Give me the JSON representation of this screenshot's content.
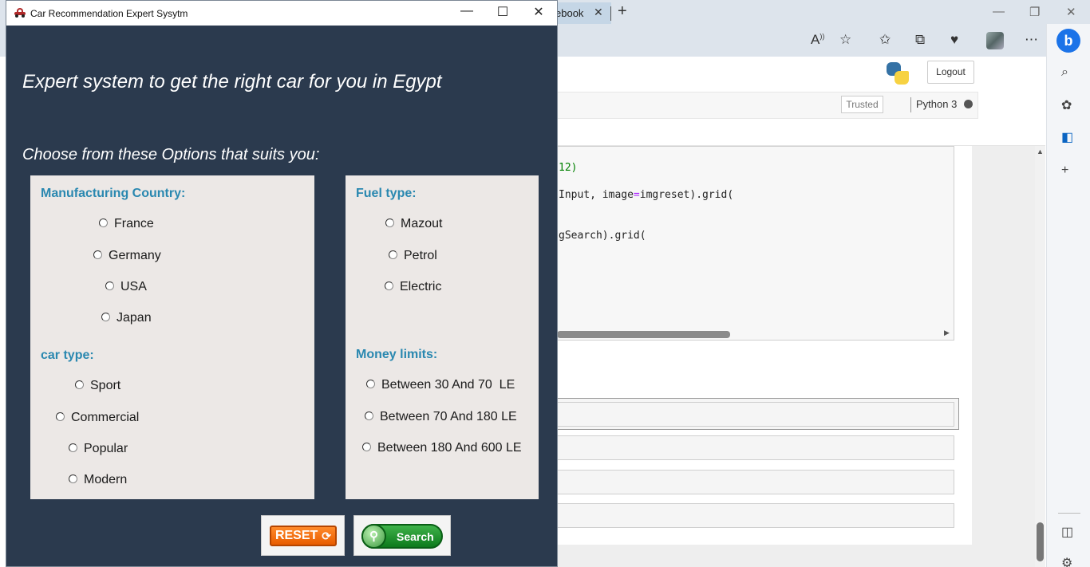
{
  "browser": {
    "tab_label": "ebook",
    "tab_close": "✕",
    "new_tab": "+",
    "win_minimize": "—",
    "win_restore": "❐",
    "win_close": "✕",
    "icons": [
      "read-aloud-icon",
      "add-favorite-icon",
      "favorites-icon",
      "collections-icon",
      "health-icon",
      "profile-icon",
      "more-icon"
    ],
    "sidebar_icons": [
      "bing-icon",
      "search-icon",
      "copilot-icon",
      "outlook-icon",
      "add-icon",
      "split-screen-icon",
      "settings-icon"
    ]
  },
  "jupyter": {
    "logout_label": "Logout",
    "trusted_label": "Trusted",
    "kernel_name": "Python 3",
    "code_lines": [
      {
        "pre": "12)",
        "num": ""
      },
      {
        "pre": "Input, image",
        "op": "=",
        "post": "imgreset).grid("
      },
      {
        "pre": "gSearch).grid(",
        "op": "",
        "post": ""
      }
    ]
  },
  "app": {
    "window_title": "Car Recommendation Expert Sysytm",
    "minimize": "—",
    "maximize": "☐",
    "close": "✕",
    "heading": "Expert system to get the right car for you in Egypt",
    "subheading": "Choose from these Options that suits you:",
    "groups": {
      "country": {
        "title": "Manufacturing Country:",
        "options": [
          "France",
          "Germany",
          "USA",
          "Japan"
        ]
      },
      "car_type": {
        "title": "car type:",
        "options": [
          "Sport",
          "Commercial",
          "Popular",
          "Modern"
        ]
      },
      "fuel": {
        "title": "Fuel type:",
        "options": [
          "Mazout",
          "Petrol",
          "Electric"
        ]
      },
      "money": {
        "title": "Money limits:",
        "options": [
          "Between 30 And 70  LE",
          "Between 70 And 180 LE",
          "Between 180 And 600 LE"
        ]
      }
    },
    "reset_label": "RESET",
    "search_label": "Search",
    "colors": {
      "window_bg": "#2b3a4e",
      "panel_bg": "#ece8e6",
      "group_title": "#2a88b0",
      "reset": "#f26f0f",
      "search": "#1f9a2e"
    }
  }
}
